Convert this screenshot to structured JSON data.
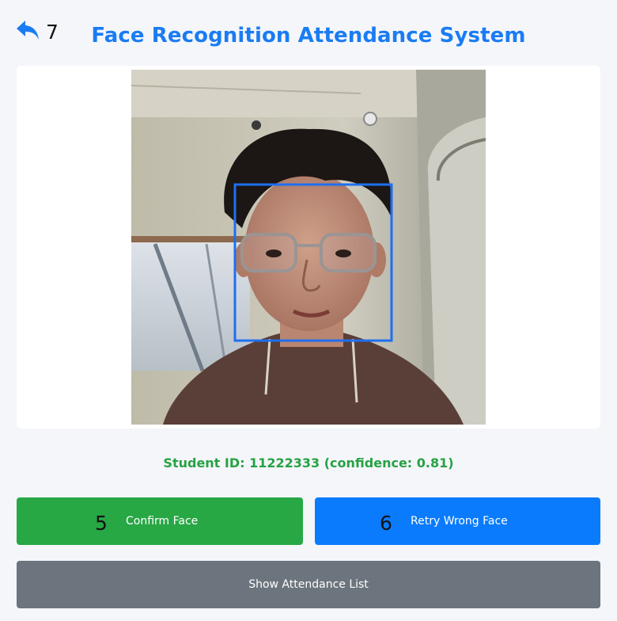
{
  "header": {
    "title": "Face Recognition Attendance System",
    "back_badge": "7"
  },
  "camera": {
    "detection_box_color": "#1e6ff0"
  },
  "status": {
    "text": "Student ID: 11222333 (confidence: 0.81)",
    "color": "#27a243"
  },
  "actions": {
    "confirm": {
      "label": "Confirm Face",
      "badge": "5",
      "color": "#28a745"
    },
    "retry": {
      "label": "Retry Wrong Face",
      "badge": "6",
      "color": "#0a7bfd"
    },
    "show_list": {
      "label": "Show Attendance List",
      "color": "#6c757d"
    }
  },
  "icons": {
    "back": "reply-arrow-icon"
  }
}
